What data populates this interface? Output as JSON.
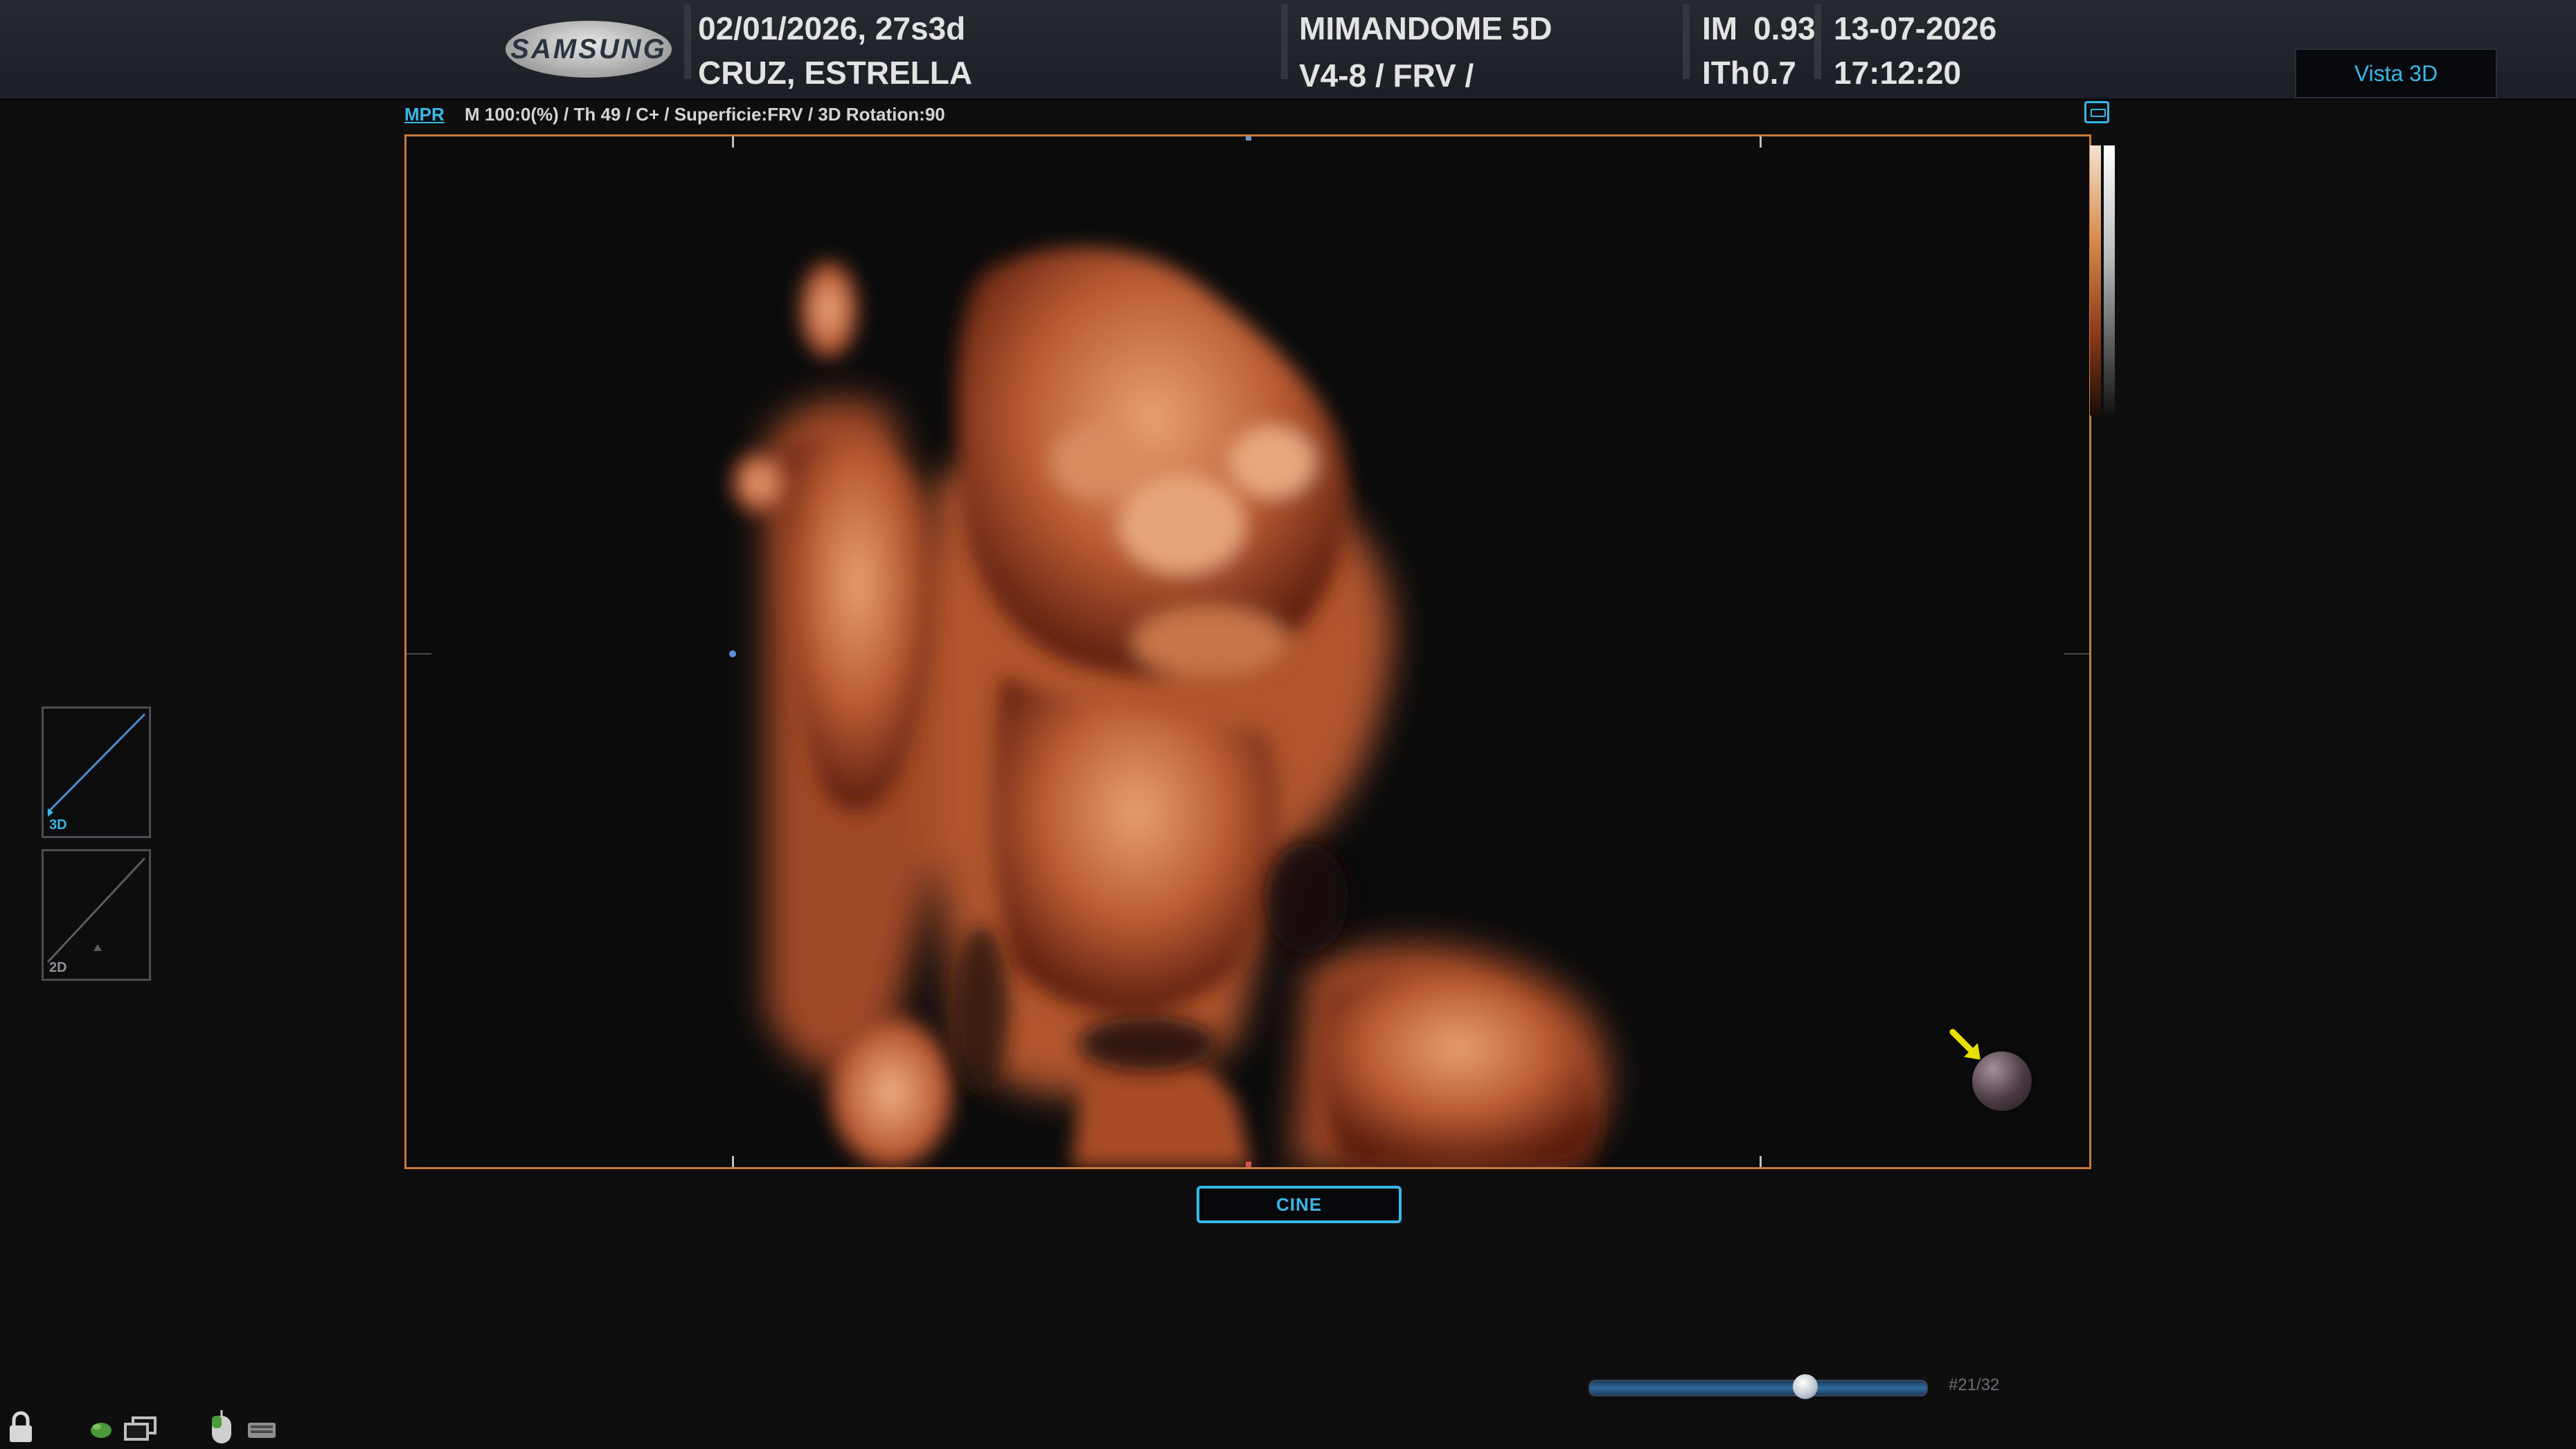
{
  "header": {
    "brand": "SAMSUNG",
    "exam_date_ga": "02/01/2026, 27s3d",
    "patient_name": "CRUZ, ESTRELLA",
    "preset": "MIMANDOME 5D",
    "probe_mode": "V4-8 / FRV /",
    "mi_label": "IM",
    "mi_value": "0.93",
    "ti_label": "ITh",
    "ti_value": "0.7",
    "date": "13-07-2026",
    "time": "17:12:20",
    "view_label": "Vista 3D"
  },
  "info": {
    "mpr_link": "MPR",
    "params": "M 100:0(%) / Th 49 / C+ / Superficie:FRV / 3D Rotation:90"
  },
  "thumbnails": [
    {
      "label": "3D"
    },
    {
      "label": "2D"
    }
  ],
  "cine_button": "CINE",
  "slider": {
    "frame_counter": "#21/32",
    "position_fraction": 0.65
  },
  "colors": {
    "accent": "#39b8e8",
    "viewport_border": "#c77a3c",
    "arrow": "#e8e000"
  },
  "icons": {
    "top_right": "layout-toggle-icon",
    "status": [
      "lock-icon",
      "leaf-icon",
      "windows-icon",
      "mouse-icon",
      "keyboard-icon"
    ]
  }
}
